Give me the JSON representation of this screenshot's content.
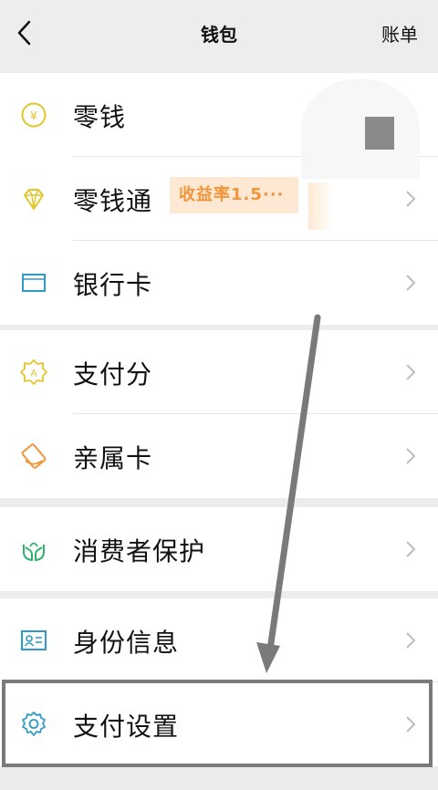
{
  "header": {
    "title": "钱包",
    "bill_label": "账单"
  },
  "groups": [
    {
      "items": [
        {
          "label": "零钱",
          "icon": "coin-icon",
          "color": "#e2c52a"
        },
        {
          "label": "零钱通",
          "icon": "diamond-icon",
          "color": "#e2c52a",
          "badge": "收益率1.5···"
        },
        {
          "label": "银行卡",
          "icon": "card-icon",
          "color": "#2e9ac8"
        }
      ]
    },
    {
      "items": [
        {
          "label": "支付分",
          "icon": "score-badge-icon",
          "color": "#e2c52a"
        },
        {
          "label": "亲属卡",
          "icon": "family-card-icon",
          "color": "#f0953b"
        }
      ]
    },
    {
      "items": [
        {
          "label": "消费者保护",
          "icon": "protection-hands-icon",
          "color": "#2fb36b"
        }
      ]
    },
    {
      "items": [
        {
          "label": "身份信息",
          "icon": "id-card-icon",
          "color": "#2e9ac8"
        },
        {
          "label": "支付设置",
          "icon": "gear-icon",
          "color": "#2e9ac8"
        }
      ]
    }
  ],
  "colors": {
    "background": "#ececec",
    "badge_bg": "#fde9d3",
    "badge_text": "#f0953b",
    "chevron": "#bdbdbd"
  }
}
